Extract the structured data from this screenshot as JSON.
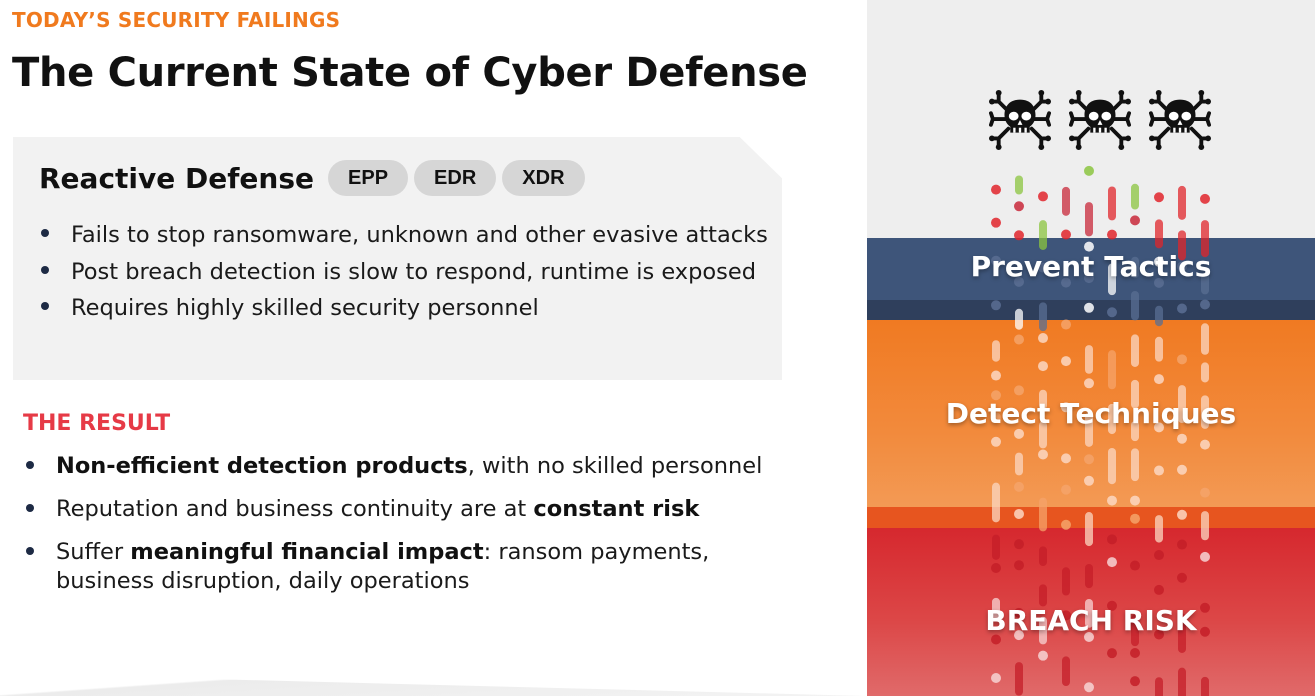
{
  "header": {
    "kicker": "TODAY’S SECURITY FAILINGS",
    "title": "The Current State of Cyber Defense"
  },
  "reactive": {
    "title": "Reactive Defense",
    "tags": [
      "EPP",
      "EDR",
      "XDR"
    ],
    "bullets": [
      "Fails to stop ransomware, unknown and other evasive attacks",
      "Post breach detection is slow to respond, runtime is exposed",
      "Requires highly skilled security personnel"
    ]
  },
  "result": {
    "title": "THE RESULT",
    "bullets": [
      {
        "before": "",
        "bold": "Non-efficient detection products",
        "after": ", with no skilled personnel"
      },
      {
        "before": "Reputation and business continuity are at ",
        "bold": "constant risk",
        "after": ""
      },
      {
        "before": "Suffer ",
        "bold": "meaningful financial impact",
        "after": ": ransom payments, business disruption, daily operations"
      }
    ]
  },
  "graphic": {
    "threat_icon": "skull-crossbones-bug-icon",
    "threat_count": 3,
    "layers": [
      {
        "label": "Prevent Tactics",
        "color": "#3e557a"
      },
      {
        "label": "Detect Techniques",
        "color": "#f07a22"
      },
      {
        "label": "BREACH RISK",
        "color": "#d6282e"
      }
    ]
  },
  "colors": {
    "kicker": "#f07a1e",
    "result_title": "#e63a46",
    "bullet": "#1d2a44",
    "panel_bg": "#f2f2f2",
    "chip_bg": "#d6d6d6"
  }
}
